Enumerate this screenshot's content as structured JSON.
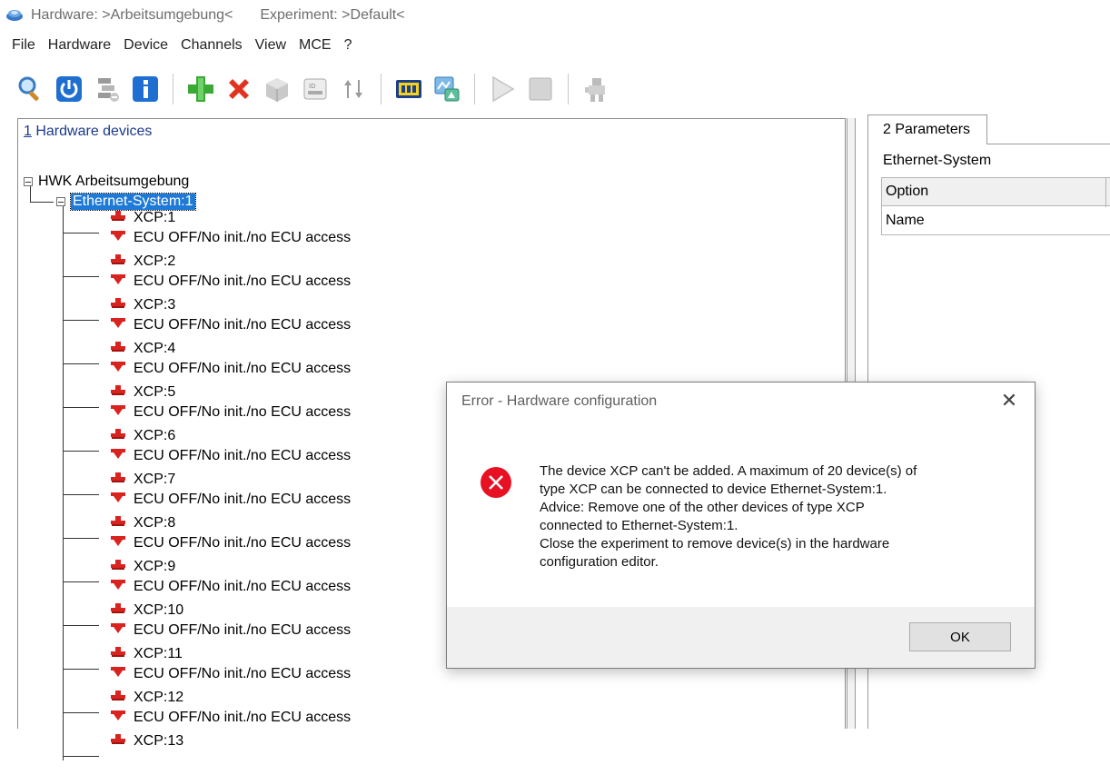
{
  "window": {
    "title_hw": "Hardware: >Arbeitsumgebung<",
    "title_exp": "Experiment: >Default<"
  },
  "menu": [
    "File",
    "Hardware",
    "Device",
    "Channels",
    "View",
    "MCE",
    "?"
  ],
  "toolbar_icons": [
    "search-icon",
    "power-icon",
    "disconnect-icon",
    "info-icon",
    "add-icon",
    "delete-icon",
    "device-icon",
    "id-icon",
    "sort-icon",
    "module-icon",
    "network-icon",
    "play-icon",
    "stop-icon",
    "robot-icon"
  ],
  "left_panel": {
    "header_num": "1",
    "header_text": " Hardware devices",
    "root": "HWK Arbeitsumgebung",
    "ethernet": "Ethernet-System:1",
    "devices": [
      {
        "name": "XCP:1",
        "status": "ECU OFF/No init./no ECU access"
      },
      {
        "name": "XCP:2",
        "status": "ECU OFF/No init./no ECU access"
      },
      {
        "name": "XCP:3",
        "status": "ECU OFF/No init./no ECU access"
      },
      {
        "name": "XCP:4",
        "status": "ECU OFF/No init./no ECU access"
      },
      {
        "name": "XCP:5",
        "status": "ECU OFF/No init./no ECU access"
      },
      {
        "name": "XCP:6",
        "status": "ECU OFF/No init./no ECU access"
      },
      {
        "name": "XCP:7",
        "status": "ECU OFF/No init./no ECU access"
      },
      {
        "name": "XCP:8",
        "status": "ECU OFF/No init./no ECU access"
      },
      {
        "name": "XCP:9",
        "status": "ECU OFF/No init./no ECU access"
      },
      {
        "name": "XCP:10",
        "status": "ECU OFF/No init./no ECU access"
      },
      {
        "name": "XCP:11",
        "status": "ECU OFF/No init./no ECU access"
      },
      {
        "name": "XCP:12",
        "status": "ECU OFF/No init./no ECU access"
      },
      {
        "name": "XCP:13",
        "status": ""
      }
    ]
  },
  "right_panel": {
    "tab": "2 Parameters",
    "section": "Ethernet-System",
    "rows": [
      "Option",
      "Name"
    ]
  },
  "dialog": {
    "title": "Error - Hardware configuration",
    "close": "✕",
    "lines": [
      "The device XCP can't be added. A maximum of 20 device(s) of",
      "type XCP can be connected to device Ethernet-System:1.",
      "Advice: Remove one of the other devices of type XCP",
      "connected to Ethernet-System:1.",
      "Close the experiment to remove device(s) in the hardware",
      "configuration editor."
    ],
    "ok": "OK"
  },
  "colors": {
    "selection": "#1e7ad6",
    "error_red": "#e81123",
    "header_blue": "#1a3a8c"
  }
}
